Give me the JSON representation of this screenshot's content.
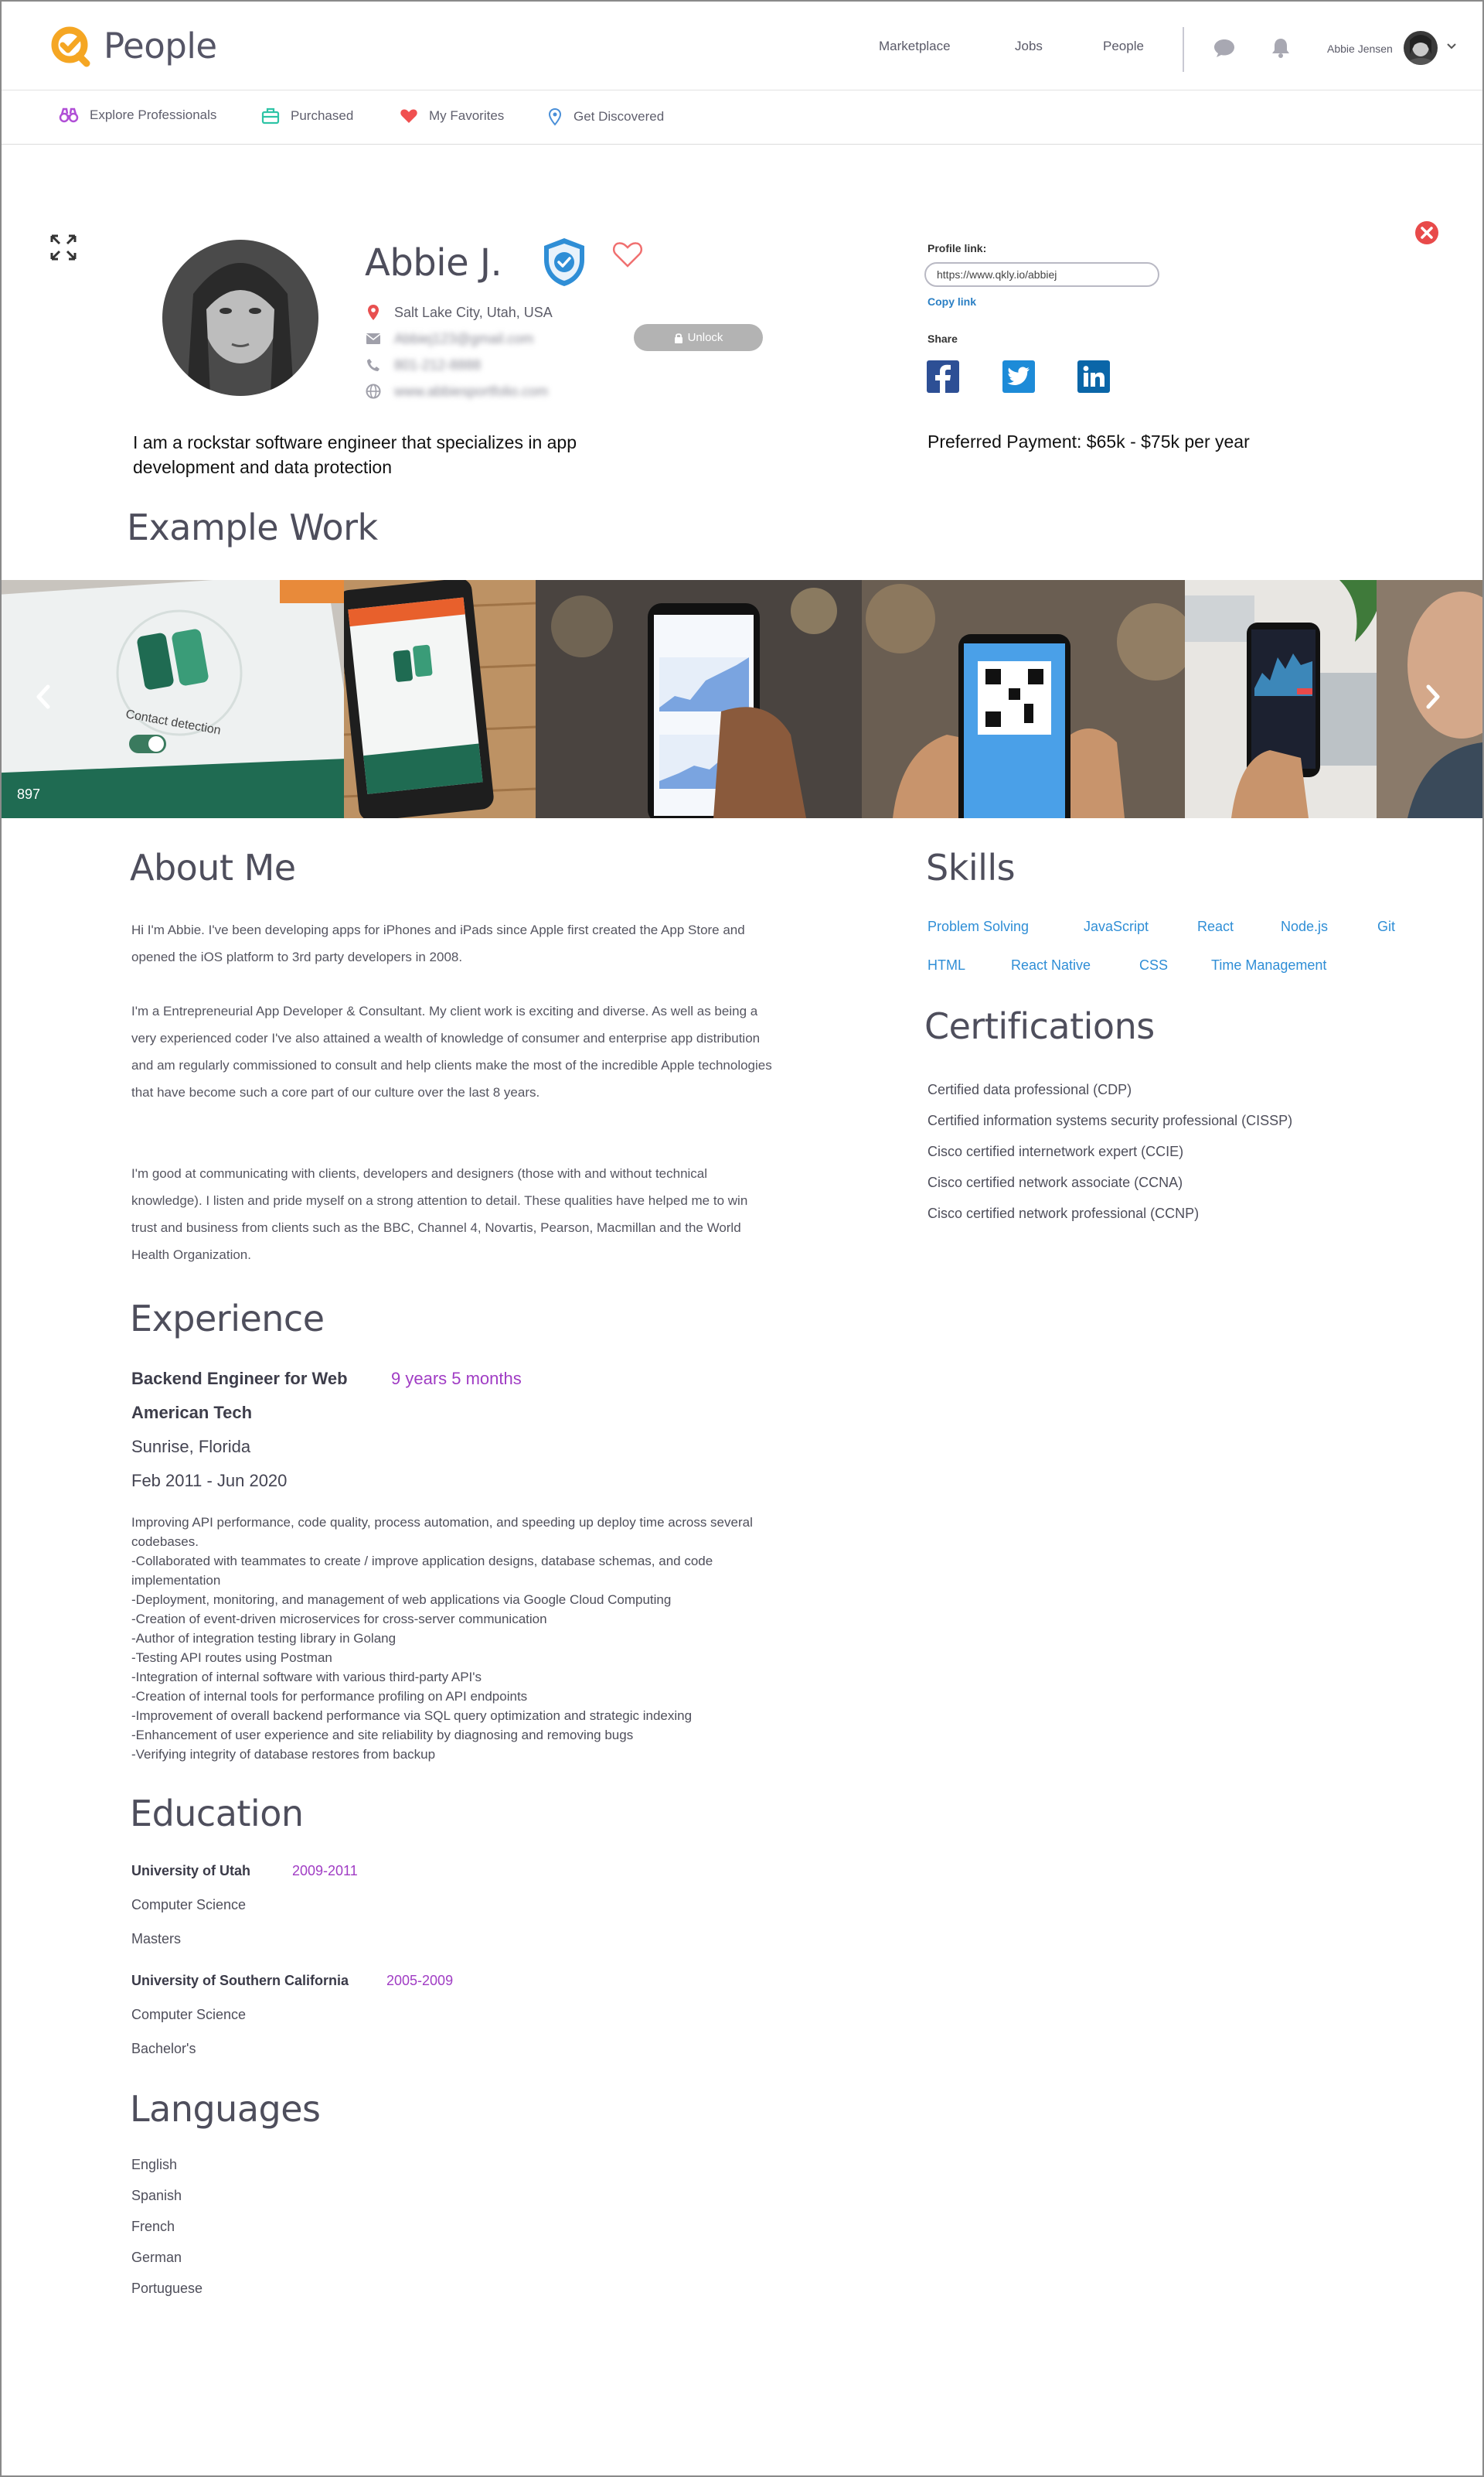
{
  "header": {
    "brand": "People",
    "nav": [
      "Marketplace",
      "Jobs",
      "People"
    ],
    "user_name": "Abbie Jensen",
    "icons": [
      "chat-icon",
      "bell-icon",
      "chevron-down-icon"
    ]
  },
  "subnav": {
    "items": [
      {
        "label": "Explore Professionals",
        "icon": "binoculars-icon",
        "color": "#b04fd6"
      },
      {
        "label": "Purchased",
        "icon": "briefcase-icon",
        "color": "#2ec4a6"
      },
      {
        "label": "My Favorites",
        "icon": "heart-icon",
        "color": "#f05050"
      },
      {
        "label": "Get Discovered",
        "icon": "location-pin-icon",
        "color": "#4a8fd8"
      }
    ]
  },
  "profile": {
    "name": "Abbie J.",
    "location": "Salt Lake City, Utah, USA",
    "email": "Abbiej123@gmail.com",
    "phone": "801-212-8888",
    "website": "www.abbiesportfolio.com",
    "unlock_label": "Unlock",
    "tagline": "I am a rockstar software engineer that specializes in app development and data protection",
    "profile_link_label": "Profile link:",
    "profile_link_value": "https://www.qkly.io/abbiej",
    "copy_link": "Copy link",
    "share_label": "Share",
    "preferred_payment": "Preferred Payment: $65k - $75k per year"
  },
  "colors": {
    "accent_orange": "#f5a623",
    "link_blue": "#2f8ed6",
    "purple": "#a03cc4",
    "facebook": "#2d4f95",
    "twitter": "#1d8bd8",
    "linkedin": "#0b66a8",
    "close_red": "#e84a4a"
  },
  "example_work": {
    "title": "Example Work"
  },
  "about": {
    "title": "About Me",
    "paragraphs": [
      "Hi I'm Abbie. I've been developing apps for iPhones and iPads since Apple first created the App Store and opened the iOS platform to 3rd party developers in 2008.",
      "I'm a Entrepreneurial App Developer & Consultant. My client work is exciting and diverse. As well as being a very experienced coder I've also attained a wealth of knowledge of consumer and enterprise app distribution and am regularly commissioned to consult and help clients make the most of the incredible Apple technologies that have become such a core part of our culture over the last 8 years.",
      "I'm good at communicating with clients, developers and designers (those with and without technical knowledge). I listen and pride myself on a strong attention to detail. These qualities have helped me to win trust and business from clients such as the BBC, Channel 4, Novartis, Pearson, Macmillan and the World Health Organization."
    ]
  },
  "skills": {
    "title": "Skills",
    "items": [
      "Problem Solving",
      "JavaScript",
      "React",
      "Node.js",
      "Git",
      "HTML",
      "React Native",
      "CSS",
      "Time Management"
    ]
  },
  "certifications": {
    "title": "Certifications",
    "items": [
      "Certified data professional (CDP)",
      "Certified information systems security professional (CISSP)",
      "Cisco certified internetwork expert (CCIE)",
      "Cisco certified network associate (CCNA)",
      "Cisco certified network professional (CCNP)"
    ]
  },
  "experience": {
    "title": "Experience",
    "role": "Backend Engineer for Web",
    "duration": "9 years 5 months",
    "company": "American Tech",
    "location": "Sunrise, Florida",
    "dates": "Feb 2011 - Jun 2020",
    "description": [
      "Improving API performance, code quality, process automation, and speeding up deploy time across several codebases.",
      "-Collaborated with teammates to create / improve application designs, database schemas, and code implementation",
      "-Deployment, monitoring, and management of web applications via Google Cloud Computing",
      "-Creation of event-driven microservices for cross-server communication",
      "-Author of integration testing library in Golang",
      "-Testing API routes using Postman",
      "-Integration of internal software with various third-party API's",
      "-Creation of internal tools for performance profiling on API endpoints",
      "-Improvement of overall backend performance via SQL query optimization and strategic indexing",
      "-Enhancement of user experience and site reliability by diagnosing and removing bugs",
      "-Verifying integrity of database restores from backup"
    ]
  },
  "education": {
    "title": "Education",
    "items": [
      {
        "school": "University of Utah",
        "years": "2009-2011",
        "field": "Computer Science",
        "degree": "Masters"
      },
      {
        "school": "University of Southern California",
        "years": "2005-2009",
        "field": "Computer Science",
        "degree": "Bachelor's"
      }
    ]
  },
  "languages": {
    "title": "Languages",
    "items": [
      "English",
      "Spanish",
      "French",
      "German",
      "Portuguese"
    ]
  }
}
